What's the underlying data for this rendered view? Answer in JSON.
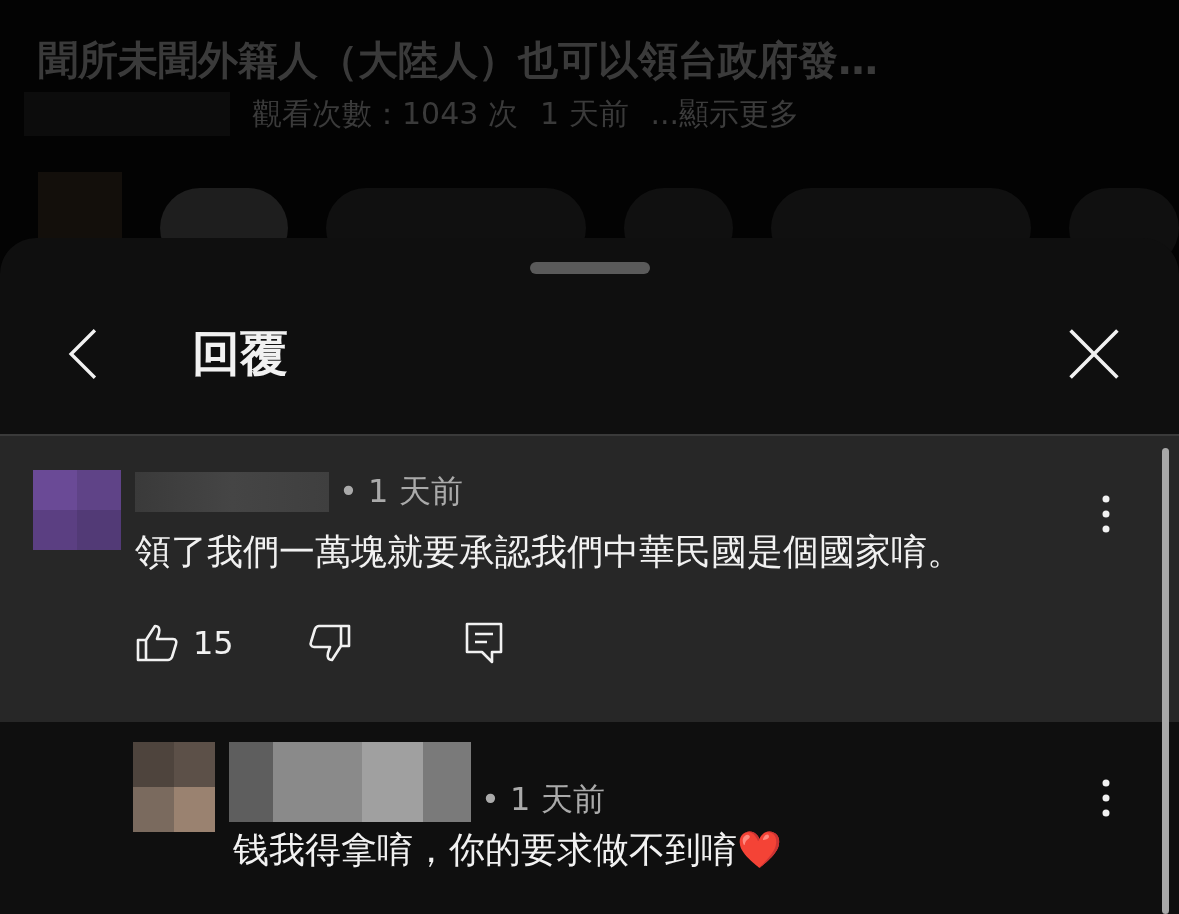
{
  "video": {
    "title": "聞所未聞外籍人（大陸人）也可以領台政府發…",
    "views": "觀看次數：1043 次",
    "age": "1 天前",
    "more": "...顯示更多"
  },
  "sheet": {
    "title": "回覆"
  },
  "comment": {
    "time": "• 1 天前",
    "text": "領了我們一萬塊就要承認我們中華民國是個國家唷。",
    "likes": "15"
  },
  "replies": [
    {
      "time": "• 1 天前",
      "text": "钱我得拿唷，你的要求做不到唷❤️"
    }
  ]
}
